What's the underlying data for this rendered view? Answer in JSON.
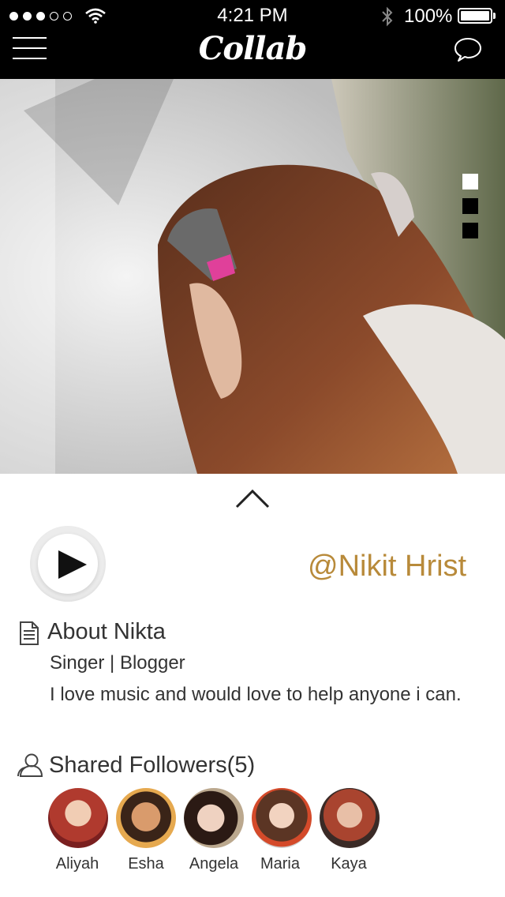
{
  "status_bar": {
    "time": "4:21 PM",
    "battery_percent": "100%",
    "signal_dots_filled": 3,
    "signal_dots_total": 5
  },
  "header": {
    "logo": "Collab",
    "menu_icon": "hamburger-menu-icon",
    "chat_icon": "chat-bubble-icon"
  },
  "hero": {
    "image": "woman-with-headphones-photo",
    "pager": {
      "count": 3,
      "active_index": 0
    }
  },
  "profile": {
    "handle": "@Nikit Hrist",
    "play_icon": "play-icon",
    "expand_icon": "chevron-up-icon"
  },
  "about": {
    "title": "About Nikta",
    "subtitle": "Singer | Blogger",
    "description": "I love music and would love to help anyone i can."
  },
  "followers": {
    "title": "Shared Followers(5)",
    "items": [
      {
        "name": "Aliyah",
        "color": "#c0392b"
      },
      {
        "name": "Esha",
        "color": "#c98a4a"
      },
      {
        "name": "Angela",
        "color": "#5a4636"
      },
      {
        "name": "Maria",
        "color": "#8e5a3c"
      },
      {
        "name": "Kaya",
        "color": "#a04a3a"
      }
    ]
  },
  "colors": {
    "header_bg": "#000000",
    "accent": "#b88a3a",
    "text": "#333333"
  }
}
